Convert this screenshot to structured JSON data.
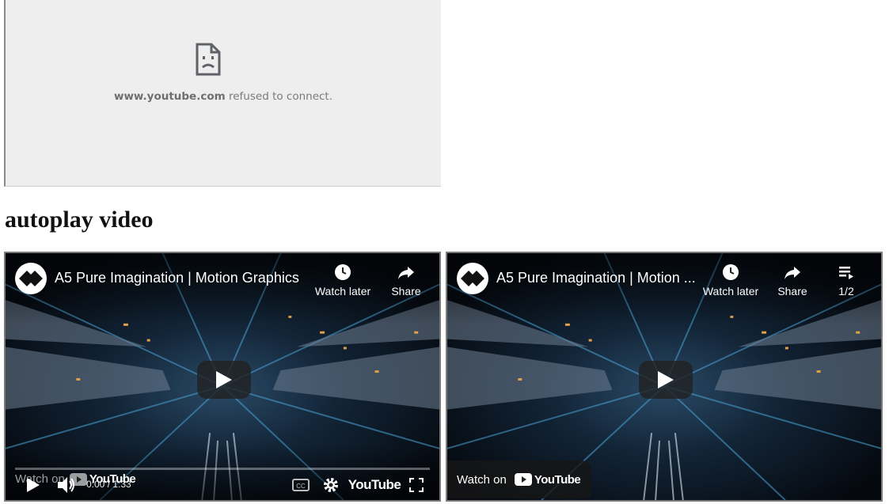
{
  "error_frame": {
    "domain": "www.youtube.com",
    "message": "refused to connect."
  },
  "heading": "autoplay video",
  "players": [
    {
      "title": "A5 Pure Imagination | Motion Graphics",
      "watch_later_label": "Watch later",
      "share_label": "Share",
      "watch_on_label": "Watch on",
      "youtube_label": "YouTube",
      "time": "0:00 / 1:33",
      "progress": 0.0
    },
    {
      "title": "A5 Pure Imagination | Motion ...",
      "watch_later_label": "Watch later",
      "share_label": "Share",
      "playlist_label": "1/2",
      "watch_on_label": "Watch on",
      "youtube_label": "YouTube"
    }
  ],
  "colors": {
    "error_bg": "#eeeeee",
    "scene_dark": "#0b1a2b",
    "scene_accent": "#4aa3d6",
    "scene_warm": "#e3a14a"
  },
  "icons": [
    "sad-document-icon",
    "channel-logo-icon",
    "clock-icon",
    "share-arrow-icon",
    "playlist-icon",
    "play-icon",
    "volume-icon",
    "cc-icon",
    "gear-icon",
    "fullscreen-icon",
    "youtube-logo-icon"
  ]
}
